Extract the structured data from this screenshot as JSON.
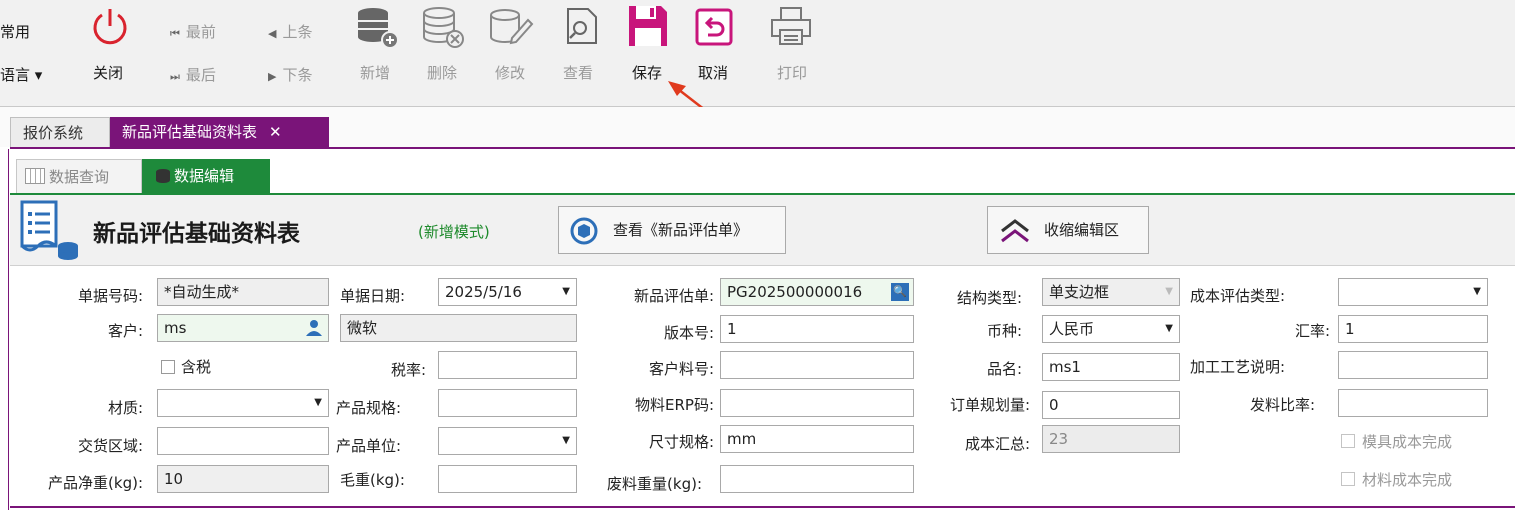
{
  "ribbon": {
    "common_label": "常用",
    "language_label": "语言 ▾",
    "close_label": "关闭",
    "first_label": "最前",
    "prev_label": "上条",
    "last_label": "最后",
    "next_label": "下条",
    "add_label": "新增",
    "delete_label": "删除",
    "edit_label": "修改",
    "view_label": "查看",
    "save_label": "保存",
    "cancel_label": "取消",
    "print_label": "打印"
  },
  "doc_tabs": {
    "quote": "报价系统",
    "newprod": "新品评估基础资料表",
    "close": "✕"
  },
  "sub_tabs": {
    "query": "数据查询",
    "edit": "数据编辑"
  },
  "header": {
    "title": "新品评估基础资料表",
    "mode": "(新增模式)",
    "view_button": "查看《新品评估单》",
    "collapse_button": "收缩编辑区"
  },
  "form": {
    "doc_no_label": "单据号码:",
    "doc_no": "*自动生成*",
    "doc_date_label": "单据日期:",
    "doc_date": "2025/5/16",
    "eval_no_label": "新品评估单:",
    "eval_no": "PG202500000016",
    "struct_type_label": "结构类型:",
    "struct_type": "单支边框",
    "cost_eval_type_label": "成本评估类型:",
    "cost_eval_type": "",
    "customer_label": "客户:",
    "customer": "ms",
    "customer_name": "微软",
    "version_label": "版本号:",
    "version": "1",
    "currency_label": "币种:",
    "currency": "人民币",
    "rate_label": "汇率:",
    "rate": "1",
    "tax_incl_label": "含税",
    "tax_rate_label": "税率:",
    "tax_rate": "",
    "cust_part_label": "客户料号:",
    "cust_part": "",
    "prod_name_label": "品名:",
    "prod_name": "ms1",
    "process_label": "加工工艺说明:",
    "process": "",
    "material_label": "材质:",
    "material": "",
    "spec_label": "产品规格:",
    "spec": "",
    "erp_label": "物料ERP码:",
    "erp": "",
    "order_qty_label": "订单规划量:",
    "order_qty": "0",
    "issue_ratio_label": "发料比率:",
    "issue_ratio": "",
    "delivery_label": "交货区域:",
    "delivery": "",
    "unit_label": "产品单位:",
    "unit": "",
    "size_label": "尺寸规格:",
    "size": "mm",
    "cost_total_label": "成本汇总:",
    "cost_total": "23",
    "mold_done_label": "模具成本完成",
    "net_weight_label": "产品净重(kg):",
    "net_weight": "10",
    "gross_label": "毛重(kg):",
    "gross": "",
    "scrap_label": "废料重量(kg):",
    "scrap": "",
    "mat_done_label": "材料成本完成"
  },
  "colors": {
    "accent_purple": "#7a1479",
    "accent_green": "#1e8a3b",
    "close_red": "#d9232e",
    "save_magenta": "#c8157b"
  }
}
